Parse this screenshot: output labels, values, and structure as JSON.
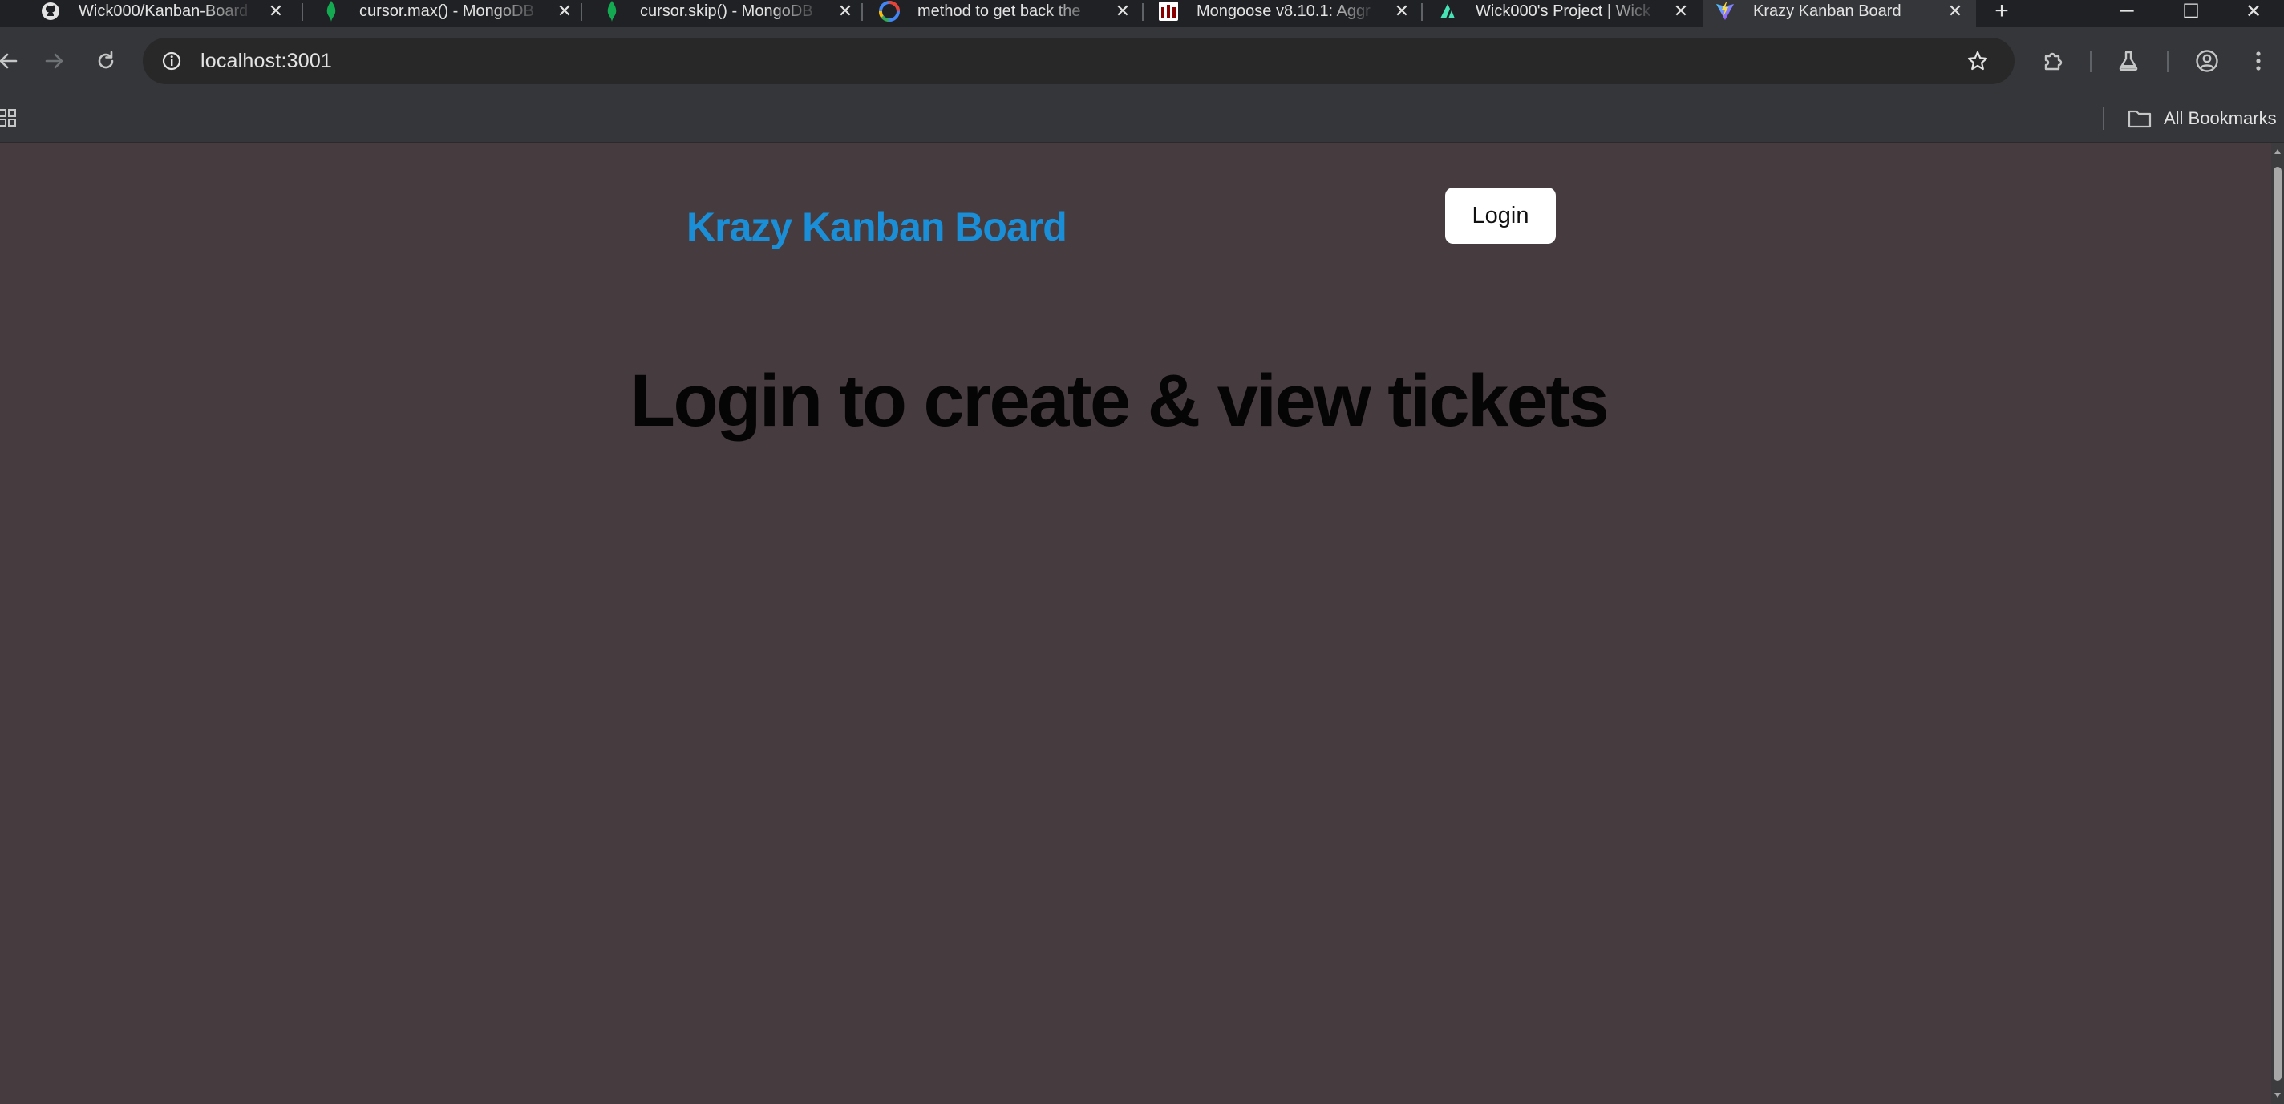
{
  "browser": {
    "tabs": [
      {
        "title": "Wick000/Kanban-Board",
        "icon": "github-icon"
      },
      {
        "title": "cursor.max() - MongoDB",
        "icon": "mongodb-leaf-icon"
      },
      {
        "title": "cursor.skip() - MongoDB",
        "icon": "mongodb-leaf-icon"
      },
      {
        "title": "method to get back the",
        "icon": "google-icon"
      },
      {
        "title": "Mongoose v8.10.1: Aggr",
        "icon": "mongoose-icon"
      },
      {
        "title": "Wick000's Project | Wick",
        "icon": "render-icon"
      },
      {
        "title": "Krazy Kanban Board",
        "icon": "vite-icon",
        "active": true
      }
    ],
    "new_tab_icon": "plus-icon",
    "window_controls": [
      "minimize-icon",
      "maximize-icon",
      "close-icon"
    ],
    "address": "localhost:3001",
    "bookmarks": {
      "all_label": "All Bookmarks"
    }
  },
  "app": {
    "brand": "Krazy Kanban Board",
    "login_label": "Login",
    "headline": "Login to create & view tickets",
    "colors": {
      "background": "#463b3e",
      "brand": "#1a8fd8",
      "headline": "#050505",
      "button_bg": "#ffffff"
    }
  }
}
